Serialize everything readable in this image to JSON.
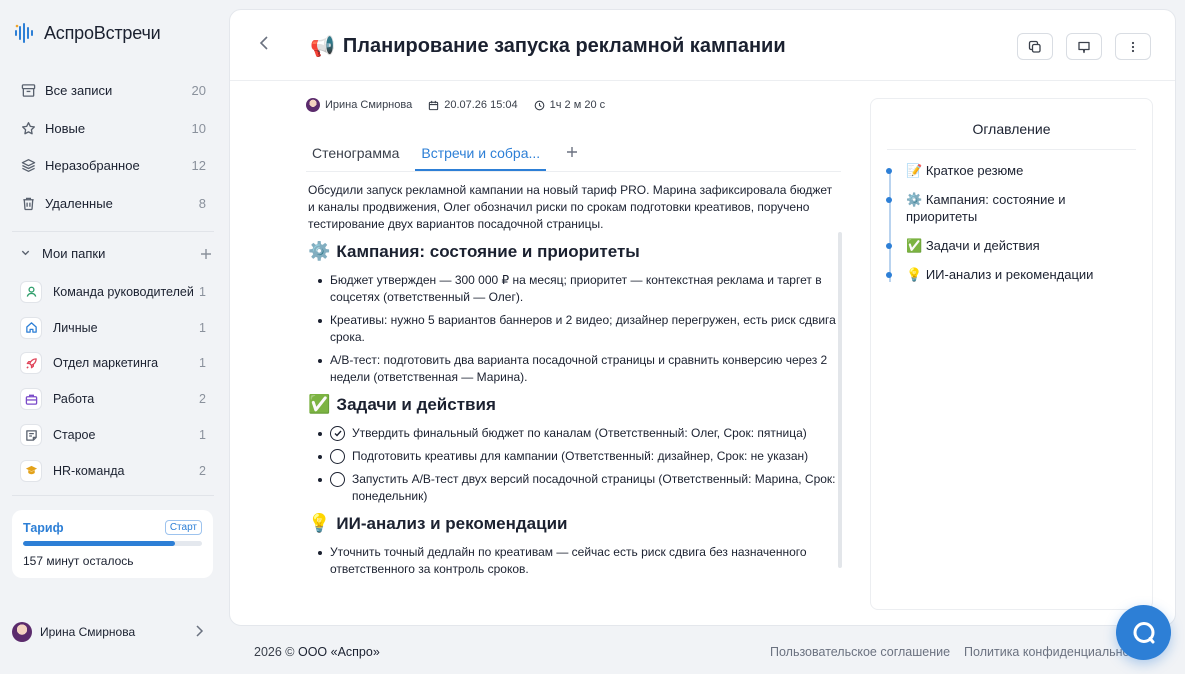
{
  "app": {
    "logo_a": "Аспро",
    "logo_b": "Встречи"
  },
  "nav": [
    {
      "label": "Все записи",
      "count": "20",
      "icon": "archive-icon"
    },
    {
      "label": "Новые",
      "count": "10",
      "icon": "star-icon"
    },
    {
      "label": "Неразобранное",
      "count": "12",
      "icon": "layers-icon"
    },
    {
      "label": "Удаленные",
      "count": "8",
      "icon": "trash-icon"
    }
  ],
  "folders_header": {
    "label": "Мои папки"
  },
  "folders": [
    {
      "label": "Команда руководителей",
      "count": "1",
      "icon": "team-icon",
      "color": "#2f9e6b"
    },
    {
      "label": "Личные",
      "count": "1",
      "icon": "home-icon",
      "color": "#2d7fd6"
    },
    {
      "label": "Отдел маркетинга",
      "count": "1",
      "icon": "rocket-icon",
      "color": "#e0455a"
    },
    {
      "label": "Работа",
      "count": "2",
      "icon": "briefcase-icon",
      "color": "#7b4bc9"
    },
    {
      "label": "Старое",
      "count": "1",
      "icon": "note-icon",
      "color": "#59616e"
    },
    {
      "label": "HR-команда",
      "count": "2",
      "icon": "graduation-icon",
      "color": "#e3a21a"
    }
  ],
  "tariff": {
    "title": "Тариф",
    "badge": "Старт",
    "progress": 0.85,
    "note": "157 минут осталось"
  },
  "user": {
    "name": "Ирина Смирнова"
  },
  "page": {
    "title_emoji": "📢",
    "title": "Планирование запуска рекламной кампании",
    "author": "Ирина Смирнова",
    "date": "20.07.26 15:04",
    "duration": "1ч 2 м 20 с"
  },
  "tabs": [
    {
      "label": "Стенограмма",
      "active": false
    },
    {
      "label": "Встречи и собра...",
      "active": true
    }
  ],
  "content": {
    "summary": "Обсудили запуск рекламной кампании на новый тариф PRO. Марина зафиксировала бюджет и каналы продвижения, Олег обозначил риски по срокам подготовки креативов, поручено тестирование двух вариантов посадочной страницы.",
    "s1": {
      "emoji": "⚙️",
      "title": "Кампания: состояние и приоритеты",
      "items": [
        "Бюджет утвержден — 300 000 ₽ на месяц; приоритет — контекстная реклама и таргет в соцсетях (ответственный — Олег).",
        "Креативы: нужно 5 вариантов баннеров и 2 видео; дизайнер перегружен, есть риск сдвига срока.",
        "A/B-тест: подготовить два варианта посадочной страницы и сравнить конверсию через 2 недели (ответственная — Марина)."
      ]
    },
    "s2": {
      "emoji": "✅",
      "title": "Задачи и действия",
      "tasks": [
        {
          "text": "Утвердить финальный бюджет по каналам (Ответственный: Олег, Срок: пятница)",
          "done": true
        },
        {
          "text": "Подготовить креативы для кампании (Ответственный: дизайнер, Срок: не указан)",
          "done": false
        },
        {
          "text": "Запустить A/B-тест двух версий посадочной страницы (Ответственный: Марина, Срок: понедельник)",
          "done": false
        }
      ]
    },
    "s3": {
      "emoji": "💡",
      "title": "ИИ-анализ и рекомендации",
      "items": [
        "Уточнить точный дедлайн по креативам — сейчас есть риск сдвига без назначенного ответственного за контроль сроков."
      ]
    }
  },
  "toc": {
    "title": "Оглавление",
    "items": [
      {
        "emoji": "📝",
        "label": "Краткое резюме"
      },
      {
        "emoji": "⚙️",
        "label": "Кампания: состояние и приоритеты"
      },
      {
        "emoji": "✅",
        "label": "Задачи и действия"
      },
      {
        "emoji": "💡",
        "label": "ИИ-анализ и рекомендации"
      }
    ]
  },
  "footer": {
    "year": "2026 ©",
    "company": "ООО «Аспро»",
    "links": [
      "Пользовательское соглашение",
      "Политика конфиденциальности"
    ]
  },
  "colors": {
    "accent": "#2d7fd6",
    "background": "#f1f3f6"
  }
}
